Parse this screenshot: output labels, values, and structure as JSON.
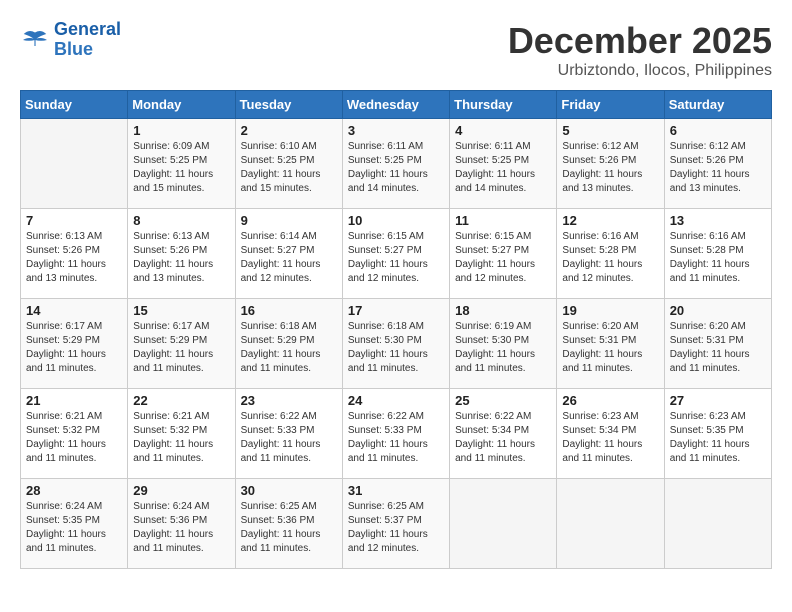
{
  "logo": {
    "line1": "General",
    "line2": "Blue"
  },
  "title": "December 2025",
  "subtitle": "Urbiztondo, Ilocos, Philippines",
  "weekdays": [
    "Sunday",
    "Monday",
    "Tuesday",
    "Wednesday",
    "Thursday",
    "Friday",
    "Saturday"
  ],
  "weeks": [
    [
      {
        "day": "",
        "info": ""
      },
      {
        "day": "1",
        "info": "Sunrise: 6:09 AM\nSunset: 5:25 PM\nDaylight: 11 hours\nand 15 minutes."
      },
      {
        "day": "2",
        "info": "Sunrise: 6:10 AM\nSunset: 5:25 PM\nDaylight: 11 hours\nand 15 minutes."
      },
      {
        "day": "3",
        "info": "Sunrise: 6:11 AM\nSunset: 5:25 PM\nDaylight: 11 hours\nand 14 minutes."
      },
      {
        "day": "4",
        "info": "Sunrise: 6:11 AM\nSunset: 5:25 PM\nDaylight: 11 hours\nand 14 minutes."
      },
      {
        "day": "5",
        "info": "Sunrise: 6:12 AM\nSunset: 5:26 PM\nDaylight: 11 hours\nand 13 minutes."
      },
      {
        "day": "6",
        "info": "Sunrise: 6:12 AM\nSunset: 5:26 PM\nDaylight: 11 hours\nand 13 minutes."
      }
    ],
    [
      {
        "day": "7",
        "info": "Sunrise: 6:13 AM\nSunset: 5:26 PM\nDaylight: 11 hours\nand 13 minutes."
      },
      {
        "day": "8",
        "info": "Sunrise: 6:13 AM\nSunset: 5:26 PM\nDaylight: 11 hours\nand 13 minutes."
      },
      {
        "day": "9",
        "info": "Sunrise: 6:14 AM\nSunset: 5:27 PM\nDaylight: 11 hours\nand 12 minutes."
      },
      {
        "day": "10",
        "info": "Sunrise: 6:15 AM\nSunset: 5:27 PM\nDaylight: 11 hours\nand 12 minutes."
      },
      {
        "day": "11",
        "info": "Sunrise: 6:15 AM\nSunset: 5:27 PM\nDaylight: 11 hours\nand 12 minutes."
      },
      {
        "day": "12",
        "info": "Sunrise: 6:16 AM\nSunset: 5:28 PM\nDaylight: 11 hours\nand 12 minutes."
      },
      {
        "day": "13",
        "info": "Sunrise: 6:16 AM\nSunset: 5:28 PM\nDaylight: 11 hours\nand 11 minutes."
      }
    ],
    [
      {
        "day": "14",
        "info": "Sunrise: 6:17 AM\nSunset: 5:29 PM\nDaylight: 11 hours\nand 11 minutes."
      },
      {
        "day": "15",
        "info": "Sunrise: 6:17 AM\nSunset: 5:29 PM\nDaylight: 11 hours\nand 11 minutes."
      },
      {
        "day": "16",
        "info": "Sunrise: 6:18 AM\nSunset: 5:29 PM\nDaylight: 11 hours\nand 11 minutes."
      },
      {
        "day": "17",
        "info": "Sunrise: 6:18 AM\nSunset: 5:30 PM\nDaylight: 11 hours\nand 11 minutes."
      },
      {
        "day": "18",
        "info": "Sunrise: 6:19 AM\nSunset: 5:30 PM\nDaylight: 11 hours\nand 11 minutes."
      },
      {
        "day": "19",
        "info": "Sunrise: 6:20 AM\nSunset: 5:31 PM\nDaylight: 11 hours\nand 11 minutes."
      },
      {
        "day": "20",
        "info": "Sunrise: 6:20 AM\nSunset: 5:31 PM\nDaylight: 11 hours\nand 11 minutes."
      }
    ],
    [
      {
        "day": "21",
        "info": "Sunrise: 6:21 AM\nSunset: 5:32 PM\nDaylight: 11 hours\nand 11 minutes."
      },
      {
        "day": "22",
        "info": "Sunrise: 6:21 AM\nSunset: 5:32 PM\nDaylight: 11 hours\nand 11 minutes."
      },
      {
        "day": "23",
        "info": "Sunrise: 6:22 AM\nSunset: 5:33 PM\nDaylight: 11 hours\nand 11 minutes."
      },
      {
        "day": "24",
        "info": "Sunrise: 6:22 AM\nSunset: 5:33 PM\nDaylight: 11 hours\nand 11 minutes."
      },
      {
        "day": "25",
        "info": "Sunrise: 6:22 AM\nSunset: 5:34 PM\nDaylight: 11 hours\nand 11 minutes."
      },
      {
        "day": "26",
        "info": "Sunrise: 6:23 AM\nSunset: 5:34 PM\nDaylight: 11 hours\nand 11 minutes."
      },
      {
        "day": "27",
        "info": "Sunrise: 6:23 AM\nSunset: 5:35 PM\nDaylight: 11 hours\nand 11 minutes."
      }
    ],
    [
      {
        "day": "28",
        "info": "Sunrise: 6:24 AM\nSunset: 5:35 PM\nDaylight: 11 hours\nand 11 minutes."
      },
      {
        "day": "29",
        "info": "Sunrise: 6:24 AM\nSunset: 5:36 PM\nDaylight: 11 hours\nand 11 minutes."
      },
      {
        "day": "30",
        "info": "Sunrise: 6:25 AM\nSunset: 5:36 PM\nDaylight: 11 hours\nand 11 minutes."
      },
      {
        "day": "31",
        "info": "Sunrise: 6:25 AM\nSunset: 5:37 PM\nDaylight: 11 hours\nand 12 minutes."
      },
      {
        "day": "",
        "info": ""
      },
      {
        "day": "",
        "info": ""
      },
      {
        "day": "",
        "info": ""
      }
    ]
  ]
}
